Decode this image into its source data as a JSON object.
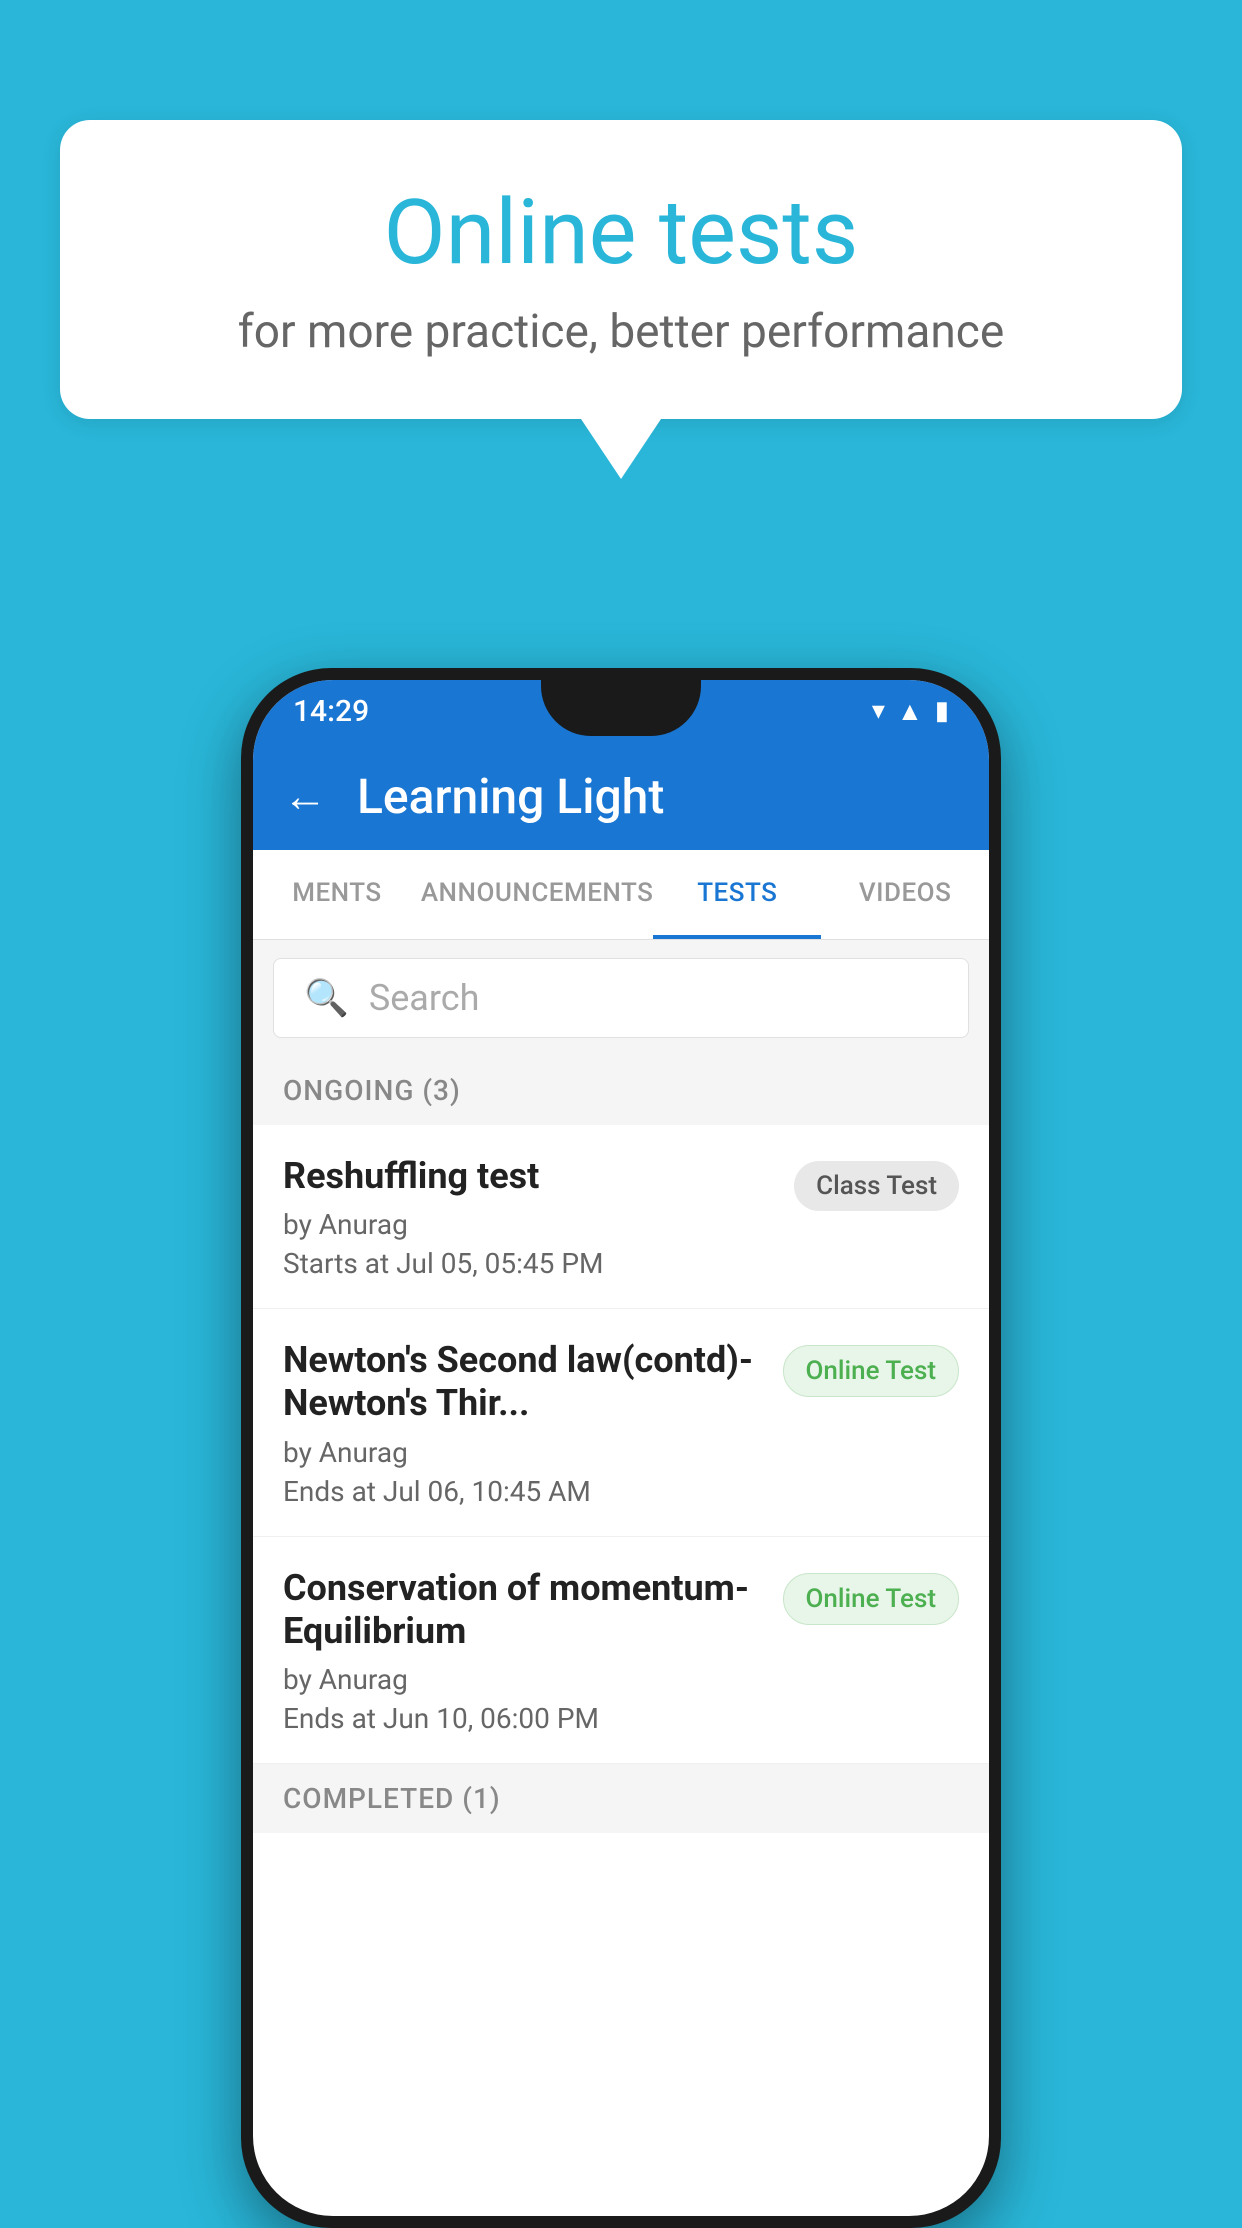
{
  "background_color": "#29b6d8",
  "speech_bubble": {
    "title": "Online tests",
    "subtitle": "for more practice, better performance"
  },
  "phone": {
    "status_bar": {
      "time": "14:29",
      "icons": [
        "wifi",
        "signal",
        "battery"
      ]
    },
    "app_bar": {
      "title": "Learning Light",
      "back_label": "←"
    },
    "tabs": [
      {
        "label": "MENTS",
        "active": false
      },
      {
        "label": "ANNOUNCEMENTS",
        "active": false
      },
      {
        "label": "TESTS",
        "active": true
      },
      {
        "label": "VIDEOS",
        "active": false
      }
    ],
    "search": {
      "placeholder": "Search"
    },
    "ongoing_section": {
      "title": "ONGOING (3)",
      "items": [
        {
          "name": "Reshuffling test",
          "author": "by Anurag",
          "time_label": "Starts at",
          "time": "Jul 05, 05:45 PM",
          "badge": "Class Test",
          "badge_type": "class"
        },
        {
          "name": "Newton's Second law(contd)-Newton's Thir...",
          "author": "by Anurag",
          "time_label": "Ends at",
          "time": "Jul 06, 10:45 AM",
          "badge": "Online Test",
          "badge_type": "online"
        },
        {
          "name": "Conservation of momentum-Equilibrium",
          "author": "by Anurag",
          "time_label": "Ends at",
          "time": "Jun 10, 06:00 PM",
          "badge": "Online Test",
          "badge_type": "online"
        }
      ]
    },
    "completed_section": {
      "title": "COMPLETED (1)"
    }
  }
}
